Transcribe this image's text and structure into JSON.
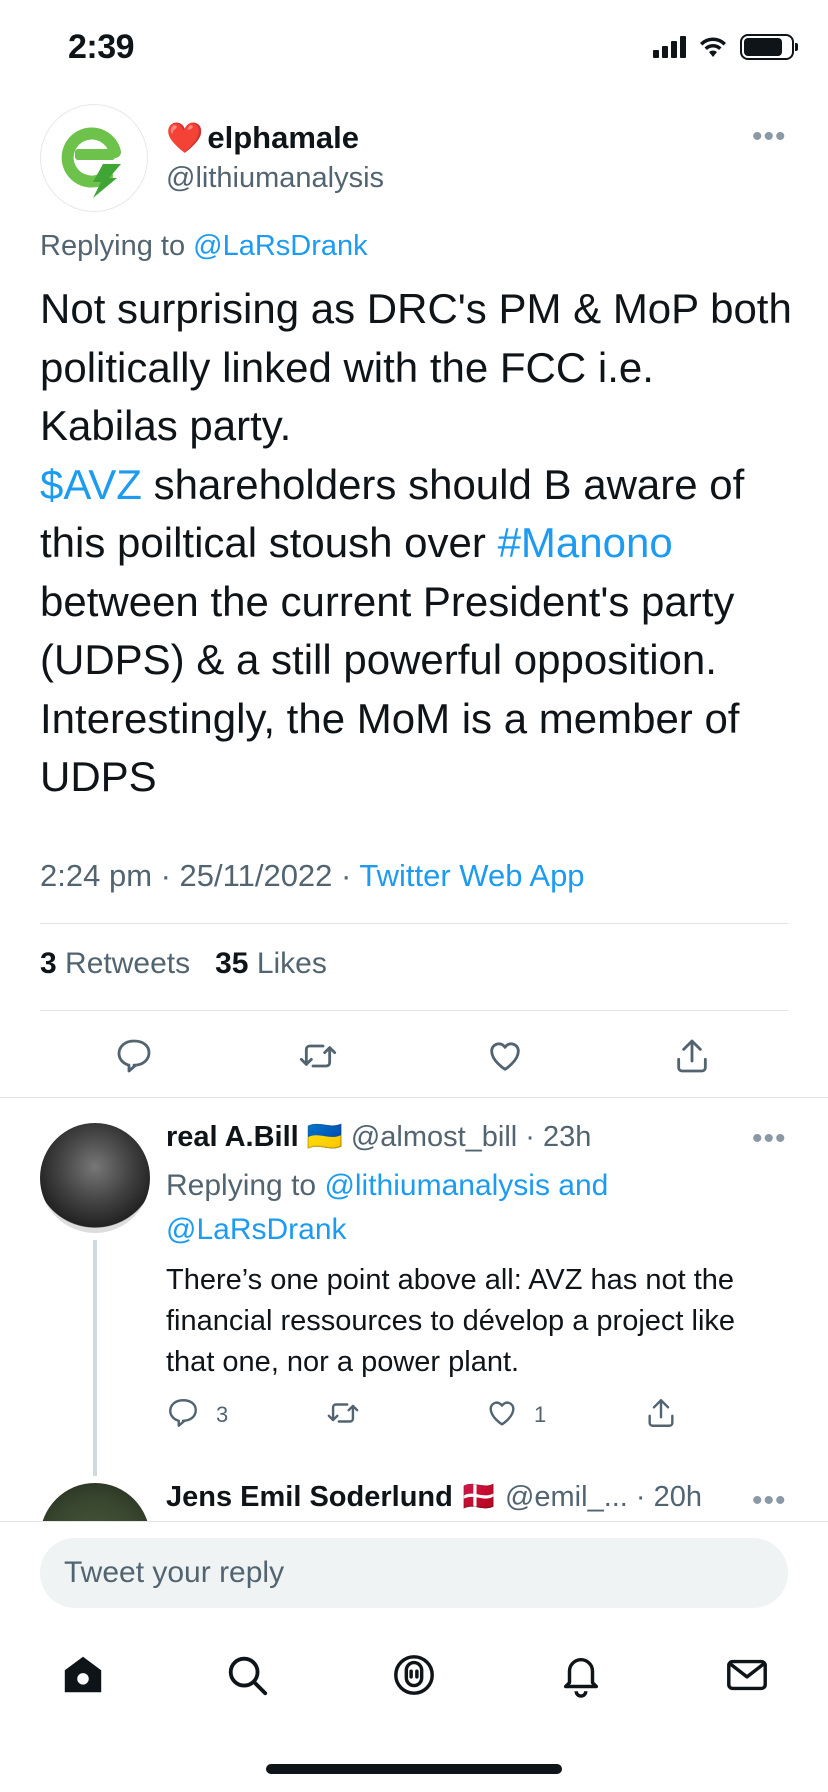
{
  "status_bar": {
    "time": "2:39"
  },
  "tweet": {
    "author": {
      "name_emoji": "❤️",
      "name": "elphamale",
      "handle": "@lithiumanalysis",
      "avatar_icon": "lightning-e-logo"
    },
    "replying_prefix": "Replying to ",
    "replying_to": "@LaRsDrank",
    "body": {
      "p1": "Not surprising as DRC's PM & MoP both politically linked with the FCC i.e. Kabilas party.",
      "cashtag": "$AVZ",
      "p2": " shareholders should B aware of this poiltical stoush over ",
      "hashtag": "#Manono",
      "p3": " between the current President's party (UDPS) & a still powerful opposition. Interestingly, the MoM is a member of UDPS"
    },
    "timestamp": "2:24 pm · 25/11/2022 · ",
    "source": "Twitter Web App",
    "retweets_count": "3",
    "retweets_label": "Retweets",
    "likes_count": "35",
    "likes_label": "Likes",
    "more_icon": "more-dots-icon"
  },
  "replies": [
    {
      "name": "real A.Bill",
      "flag": "🇺🇦",
      "handle": "@almost_bill",
      "time": "· 23h",
      "replying_prefix": "Replying to ",
      "replying_to": "@lithiumanalysis and @LaRsDrank",
      "text": "There’s one point above all: AVZ has not the financial ressources to dévelop a project like that one, nor a power plant.",
      "reply_count": "3",
      "like_count": "1"
    },
    {
      "name": "Jens Emil Soderlund",
      "flag": "🇩🇰",
      "handle": "@emil_...",
      "time": "· 20h"
    }
  ],
  "compose": {
    "placeholder": "Tweet your reply"
  },
  "tab_bar": [
    "home-icon",
    "search-icon",
    "spaces-icon",
    "notifications-icon",
    "messages-icon"
  ],
  "colors": {
    "link": "#1d9bf0",
    "secondary_text": "#536471",
    "logo_green": "#6cc24a"
  }
}
